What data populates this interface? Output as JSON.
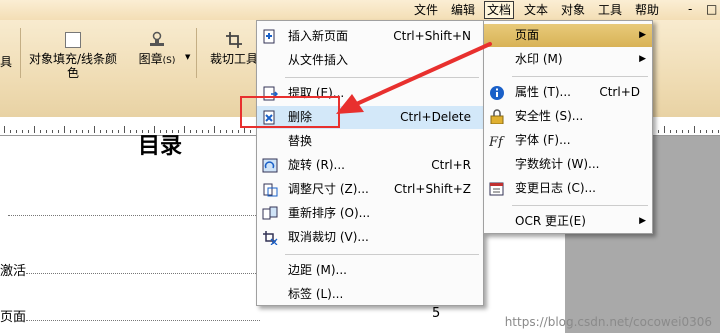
{
  "menubar": {
    "items": [
      "文件",
      "编辑",
      "文档",
      "文本",
      "对象",
      "工具",
      "帮助"
    ],
    "active": "文档",
    "window_controls": [
      "-",
      "□"
    ]
  },
  "toolbar": {
    "partial_label": "具",
    "fill_label": "对象填充/线条颜色",
    "stamp_label": "图章",
    "stamp_suffix": "(S)",
    "crop_label": "裁切工具"
  },
  "document": {
    "title": "目录",
    "toc": [
      {
        "text": "",
        "page": ""
      },
      {
        "text": "激活",
        "page": ""
      },
      {
        "text": "页面",
        "page": "5"
      }
    ]
  },
  "doc_menu": {
    "items": [
      {
        "label": "插入新页面",
        "shortcut": "Ctrl+Shift+N",
        "icon": "insert-page-icon"
      },
      {
        "label": "从文件插入",
        "shortcut": "",
        "icon": ""
      },
      {
        "sep": true
      },
      {
        "label": "提取 (E)...",
        "shortcut": "",
        "icon": "extract-page-icon"
      },
      {
        "label": "删除",
        "shortcut": "Ctrl+Delete",
        "icon": "delete-page-icon"
      },
      {
        "label": "替换",
        "shortcut": "",
        "icon": ""
      },
      {
        "label": "旋转 (R)...",
        "shortcut": "Ctrl+R",
        "icon": "rotate-page-icon"
      },
      {
        "label": "调整尺寸 (Z)...",
        "shortcut": "Ctrl+Shift+Z",
        "icon": "resize-page-icon"
      },
      {
        "label": "重新排序 (O)...",
        "shortcut": "",
        "icon": "reorder-pages-icon"
      },
      {
        "label": "取消裁切 (V)...",
        "shortcut": "",
        "icon": "uncrop-icon"
      },
      {
        "sep": true
      },
      {
        "label": "边距 (M)...",
        "shortcut": "",
        "icon": ""
      },
      {
        "label": "标签 (L)...",
        "shortcut": "",
        "icon": ""
      }
    ]
  },
  "sub_menu": {
    "items": [
      {
        "label": "页面",
        "shortcut": "",
        "arrow": true,
        "icon": ""
      },
      {
        "label": "水印 (M)",
        "shortcut": "",
        "arrow": true,
        "icon": ""
      },
      {
        "sep": true
      },
      {
        "label": "属性 (T)...",
        "shortcut": "Ctrl+D",
        "icon": "info-icon"
      },
      {
        "label": "安全性 (S)...",
        "shortcut": "",
        "icon": "lock-icon"
      },
      {
        "label": "字体 (F)...",
        "shortcut": "",
        "icon": "font-icon"
      },
      {
        "label": "字数统计 (W)...",
        "shortcut": "",
        "icon": ""
      },
      {
        "label": "变更日志 (C)...",
        "shortcut": "",
        "icon": "changelog-icon"
      },
      {
        "sep": true
      },
      {
        "label": "OCR 更正(E)",
        "shortcut": "",
        "arrow": true,
        "icon": ""
      }
    ]
  },
  "colors": {
    "highlight_box": "#e8302e",
    "arrow": "#e8302e",
    "selected_blue": "#d3e8f9",
    "selected_gold": "#dcb65c"
  },
  "watermark": "https://blog.csdn.net/cocowei0306"
}
